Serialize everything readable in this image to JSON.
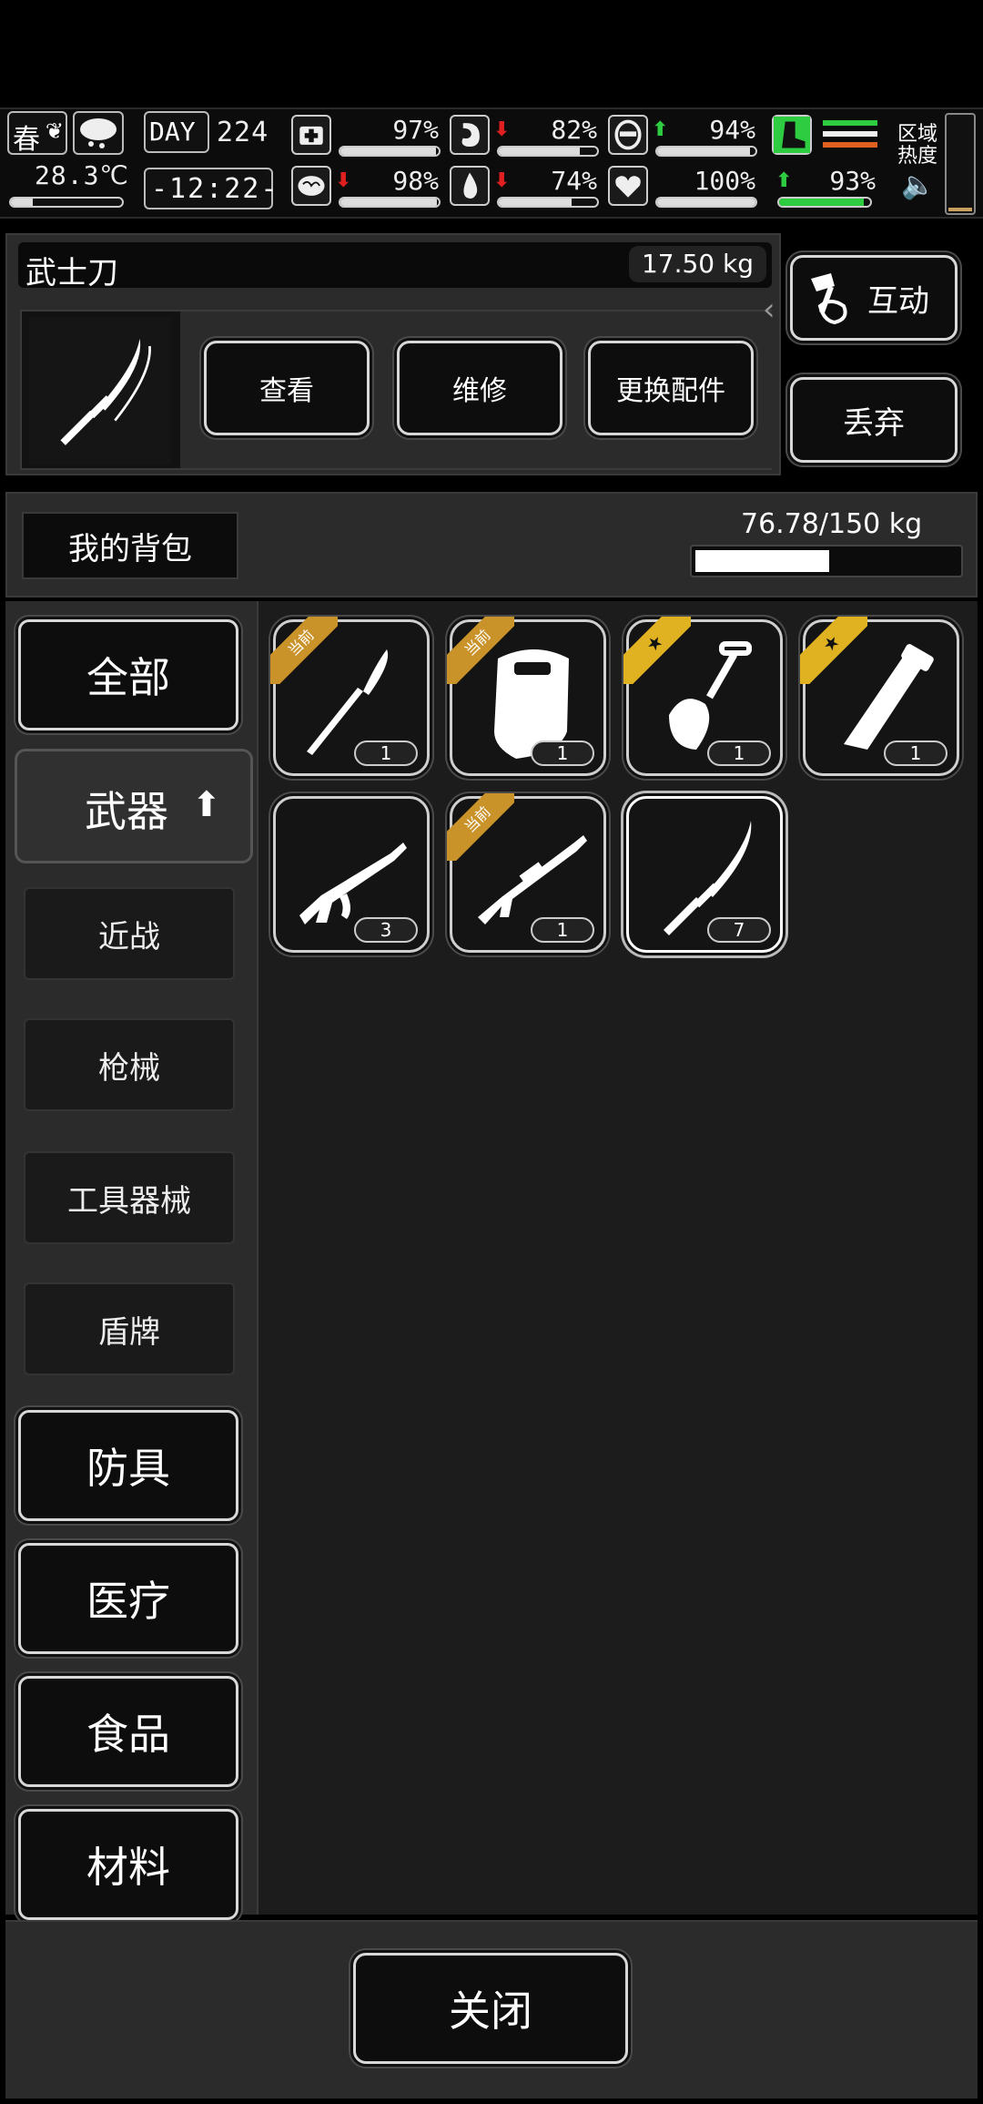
{
  "status_bar": {
    "season": "春",
    "temperature": "28.3℃",
    "day_label": "DAY",
    "day_number": "224",
    "clock": "-12:22-",
    "zone_heat_label": "区域\n热度",
    "stats": [
      {
        "name": "health",
        "icon": "medkit-icon",
        "value": "97%",
        "level": 0.97,
        "arrow": ""
      },
      {
        "name": "hunger",
        "icon": "stomach-icon",
        "value": "82%",
        "level": 0.82,
        "arrow": "down"
      },
      {
        "name": "armor",
        "icon": "helmet-icon",
        "value": "94%",
        "level": 0.94,
        "arrow": "up"
      },
      {
        "name": "mind",
        "icon": "brain-icon",
        "value": "98%",
        "level": 0.98,
        "arrow": "down"
      },
      {
        "name": "thirst",
        "icon": "water-drop-icon",
        "value": "74%",
        "level": 0.74,
        "arrow": "down"
      },
      {
        "name": "mood",
        "icon": "heart-icon",
        "value": "100%",
        "level": 1.0,
        "arrow": ""
      },
      {
        "name": "stamina",
        "icon": "boot-icon",
        "value": "93%",
        "level": 0.93,
        "arrow": "up"
      }
    ]
  },
  "selected_item": {
    "name": "武士刀",
    "weight": "17.50 kg",
    "icon": "katana-icon",
    "actions": {
      "view": "查看",
      "repair": "维修",
      "attachments": "更换配件"
    }
  },
  "side_actions": {
    "interact": "互动",
    "discard": "丢弃"
  },
  "backpack": {
    "label": "我的背包",
    "weight": "76.78/150 kg",
    "fill": 0.51
  },
  "categories": {
    "all": "全部",
    "weapons": "武器",
    "melee": "近战",
    "firearms": "枪械",
    "tools": "工具器械",
    "shields": "盾牌",
    "armor": "防具",
    "medical": "医疗",
    "food": "食品",
    "materials": "材料"
  },
  "items": [
    {
      "icon": "scalpel-icon",
      "count": "1",
      "badge": "当前"
    },
    {
      "icon": "riot-shield-icon",
      "count": "1",
      "badge": "当前"
    },
    {
      "icon": "shovel-icon",
      "count": "1",
      "badge": "star"
    },
    {
      "icon": "machete-icon",
      "count": "1",
      "badge": "star"
    },
    {
      "icon": "ak-rifle-icon",
      "count": "3",
      "badge": ""
    },
    {
      "icon": "m16-rifle-icon",
      "count": "1",
      "badge": "当前"
    },
    {
      "icon": "katana-icon",
      "count": "7",
      "badge": ""
    }
  ],
  "close_label": "关闭",
  "colors": {
    "badge_current": "#c9932a",
    "badge_star": "#e0b221",
    "stat_good": "#2ecc40",
    "stat_bad": "#e02020"
  }
}
